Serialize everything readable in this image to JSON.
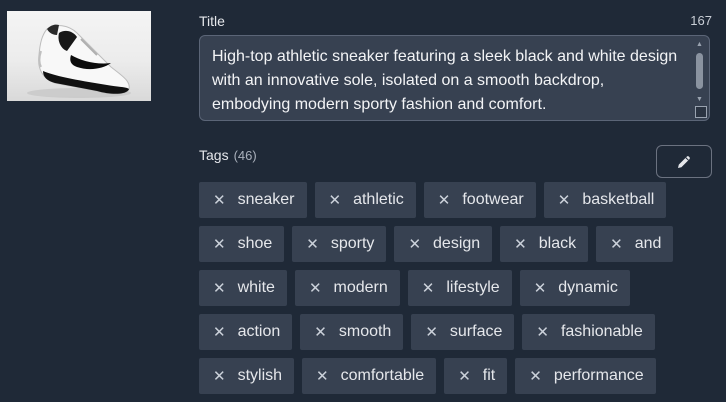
{
  "image": {
    "alt_icon": "sneaker-thumbnail"
  },
  "title": {
    "label": "Title",
    "char_count": "167",
    "value": "High-top athletic sneaker featuring a sleek black and white design with an innovative sole, isolated on a smooth backdrop, embodying modern sporty fashion and comfort."
  },
  "tags": {
    "label": "Tags",
    "count": "(46)",
    "edit_icon": "pencil-icon",
    "remove_glyph": "✕",
    "items": [
      "sneaker",
      "athletic",
      "footwear",
      "basketball",
      "shoe",
      "sporty",
      "design",
      "black",
      "and",
      "white",
      "modern",
      "lifestyle",
      "dynamic",
      "action",
      "smooth",
      "surface",
      "fashionable",
      "stylish",
      "comfortable",
      "fit",
      "performance"
    ]
  }
}
